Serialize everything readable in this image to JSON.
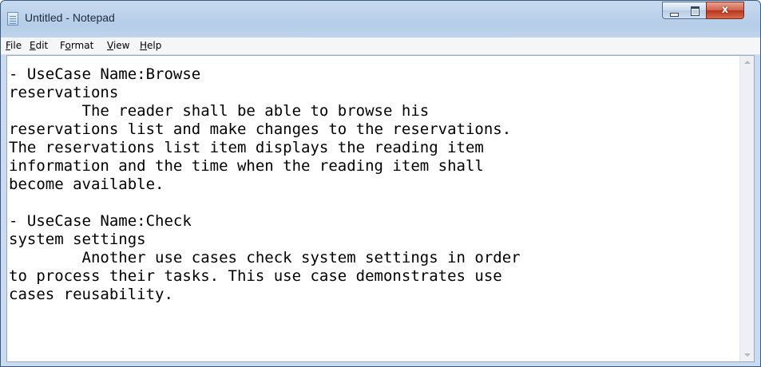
{
  "window": {
    "title": "Untitled - Notepad",
    "controls": {
      "minimize_icon": "minimize-icon",
      "maximize_icon": "maximize-icon",
      "close_label": "x"
    }
  },
  "menu": {
    "items": [
      {
        "pre": "",
        "key": "F",
        "post": "ile"
      },
      {
        "pre": "",
        "key": "E",
        "post": "dit"
      },
      {
        "pre": "F",
        "key": "o",
        "post": "rmat"
      },
      {
        "pre": "",
        "key": "V",
        "post": "iew"
      },
      {
        "pre": "",
        "key": "H",
        "post": "elp"
      }
    ]
  },
  "document": {
    "lines": [
      "- UseCase Name:Browse",
      "reservations",
      "        The reader shall be able to browse his",
      "reservations list and make changes to the reservations.",
      "The reservations list item displays the reading item",
      "information and the time when the reading item shall",
      "become available.",
      "",
      "- UseCase Name:Check",
      "system settings",
      "        Another use cases check system settings in order",
      "to process their tasks. This use case demonstrates use",
      "cases reusability."
    ]
  },
  "colors": {
    "title_bar": "#c7daef",
    "close_button": "#c9452c",
    "text": "#000000"
  }
}
